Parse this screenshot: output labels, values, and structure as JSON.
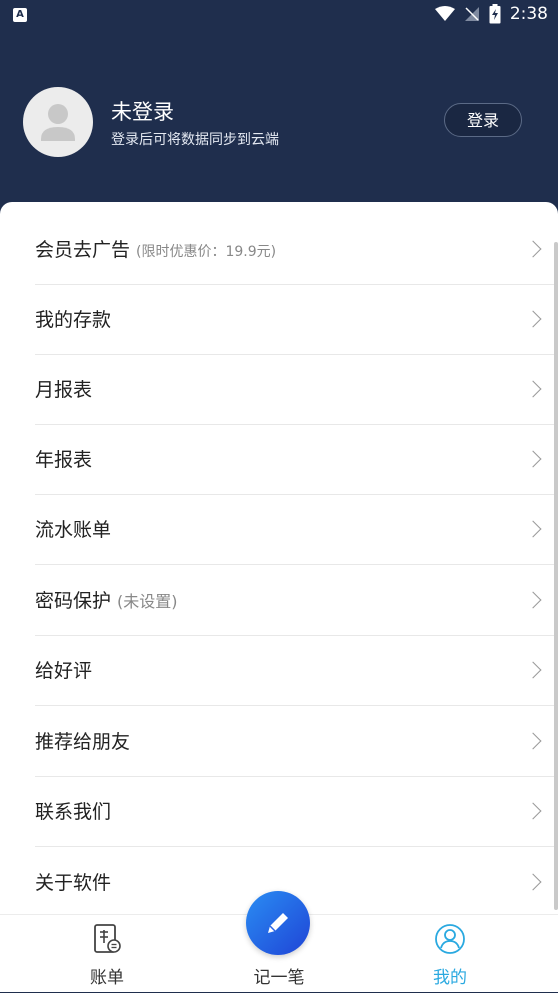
{
  "status_bar": {
    "app_icon": "A",
    "time": "2:38",
    "icons": [
      "wifi-icon",
      "signal-off-icon",
      "battery-charging-icon"
    ]
  },
  "profile": {
    "title": "未登录",
    "subtitle": "登录后可将数据同步到云端",
    "login_label": "登录",
    "avatar_icon": "user-avatar-icon"
  },
  "menu": {
    "items": [
      {
        "label": "会员去广告",
        "note": "(限时优惠价：19.9元)"
      },
      {
        "label": "我的存款",
        "note": ""
      },
      {
        "label": "月报表",
        "note": ""
      },
      {
        "label": "年报表",
        "note": ""
      },
      {
        "label": "流水账单",
        "note": ""
      },
      {
        "label": "密码保护",
        "note": "(未设置)"
      },
      {
        "label": "给好评",
        "note": ""
      },
      {
        "label": "推荐给朋友",
        "note": ""
      },
      {
        "label": "联系我们",
        "note": ""
      },
      {
        "label": "关于软件",
        "note": ""
      }
    ]
  },
  "tabbar": {
    "tabs": [
      {
        "label": "账单",
        "icon": "bill-icon",
        "active": false
      },
      {
        "label": "记一笔",
        "icon": "pencil-icon",
        "active": false
      },
      {
        "label": "我的",
        "icon": "profile-icon",
        "active": true
      }
    ]
  },
  "colors": {
    "header_bg": "#1f2e4d",
    "accent": "#2aa9e0",
    "fab_gradient_start": "#2a8df3",
    "fab_gradient_end": "#1f44d6"
  }
}
